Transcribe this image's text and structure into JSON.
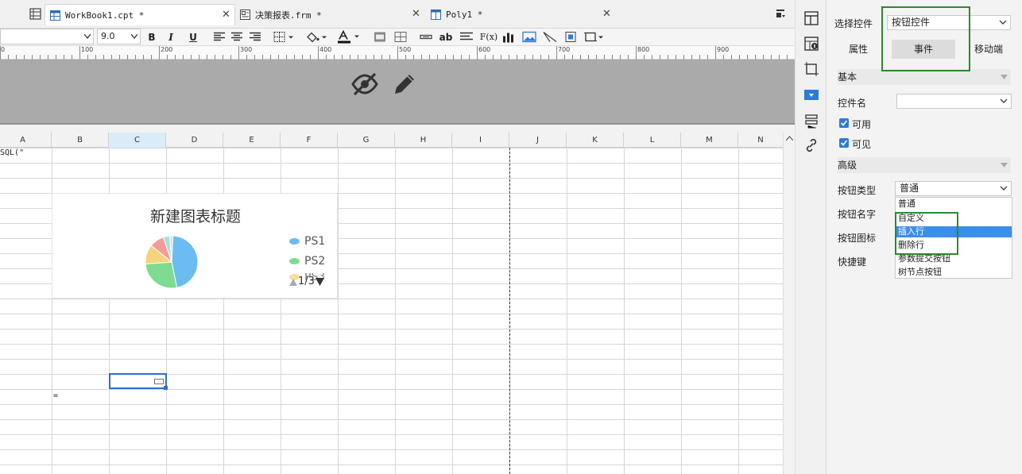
{
  "colors": {
    "accent": "#3d8ee8",
    "highlight_box": "#2c8a2c",
    "header_band": "#aaaaaa",
    "checkbox": "#2d7bd6"
  },
  "tabs": [
    {
      "label": "WorkBook1.cpt *",
      "icon": "workbook-icon"
    },
    {
      "label": "决策报表.frm *",
      "icon": "form-report-icon"
    },
    {
      "label": "Poly1 *",
      "icon": "poly-report-icon"
    }
  ],
  "toolbar": {
    "font_value": "",
    "size_value": "9.0",
    "bold": "B",
    "italic": "I",
    "underline": "U",
    "text_button": "ab",
    "formula_button": "F(x)"
  },
  "ruler": {
    "labels": [
      "0",
      "100",
      "200",
      "300",
      "400",
      "500",
      "600",
      "700",
      "800",
      "900"
    ]
  },
  "columns": [
    "A",
    "B",
    "C",
    "D",
    "E",
    "F",
    "G",
    "H",
    "I",
    "J",
    "K",
    "L",
    "M",
    "N"
  ],
  "cells": {
    "a1": "SQL(\"",
    "a17": "="
  },
  "chart_data": {
    "type": "pie",
    "title": "新建图表标题",
    "series": [
      {
        "name": "PS1",
        "value": 46,
        "color": "#6cbcf2"
      },
      {
        "name": "PS2",
        "value": 27,
        "color": "#7ddc92"
      },
      {
        "name": "PS3",
        "value": 12,
        "color": "#f5d47c"
      },
      {
        "name": "",
        "value": 9,
        "color": "#f49a9a"
      },
      {
        "name": "",
        "value": 4,
        "color": "#a9e0d8"
      },
      {
        "name": "",
        "value": 2,
        "color": "#c9e6f7"
      }
    ],
    "legend_visible": [
      "PS1",
      "PS2",
      "PS3"
    ],
    "legend_placement": "right",
    "legend_pager": "1/3"
  },
  "panel": {
    "select_control_label": "选择控件",
    "select_control_value": "按钮控件",
    "tabs": [
      "属性",
      "事件",
      "移动端"
    ],
    "active_tab": "事件",
    "basic_section": "基本",
    "control_name_label": "控件名",
    "control_name_value": "",
    "enabled_label": "可用",
    "visible_label": "可见",
    "advanced_section": "高级",
    "button_type_label": "按钮类型",
    "button_type_value": "普通",
    "button_name_label": "按钮名字",
    "button_icon_label": "按钮图标",
    "shortcut_label": "快捷键",
    "button_type_options": [
      "普通",
      "自定义",
      "插入行",
      "删除行",
      "参数提交按钮",
      "树节点按钮"
    ],
    "highlighted_option": "插入行"
  }
}
